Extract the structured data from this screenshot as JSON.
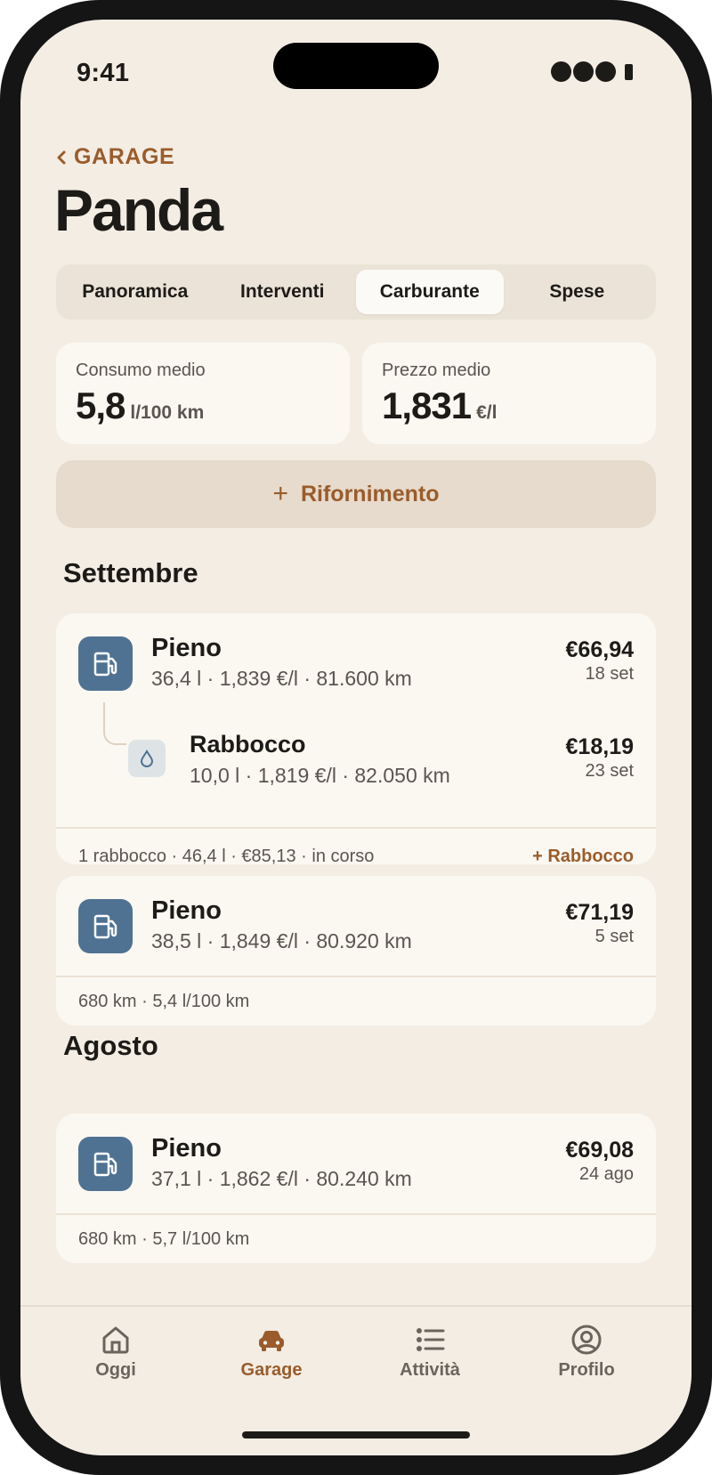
{
  "status_bar": {
    "time": "9:41"
  },
  "nav": {
    "back_label": "GARAGE",
    "title": "Panda"
  },
  "tabs": [
    {
      "label": "Panoramica",
      "active": false
    },
    {
      "label": "Interventi",
      "active": false
    },
    {
      "label": "Carburante",
      "active": true
    },
    {
      "label": "Spese",
      "active": false
    }
  ],
  "stats": {
    "consumption": {
      "label": "Consumo medio",
      "value": "5,8",
      "unit": "l/100 km"
    },
    "price": {
      "label": "Prezzo medio",
      "value": "1,831",
      "unit": "€/l"
    }
  },
  "add_button": {
    "label": "Rifornimento"
  },
  "months": [
    {
      "name": "Settembre",
      "cards": [
        {
          "entries": [
            {
              "type": "Pieno",
              "details": "36,4 l · 1,839 €/l · 81.600 km",
              "price": "€66,94",
              "date": "18 set"
            },
            {
              "type": "Rabbocco",
              "details": "10,0 l · 1,819 €/l · 82.050 km",
              "price": "€18,19",
              "date": "23 set"
            }
          ],
          "footer": "1 rabbocco · 46,4 l · €85,13 · in corso",
          "footer_action": "+ Rabbocco"
        },
        {
          "entries": [
            {
              "type": "Pieno",
              "details": "38,5 l · 1,849 €/l · 80.920 km",
              "price": "€71,19",
              "date": "5 set"
            }
          ],
          "footer": "680 km · 5,4 l/100 km"
        }
      ]
    },
    {
      "name": "Agosto",
      "cards": [
        {
          "entries": [
            {
              "type": "Pieno",
              "details": "37,1 l · 1,862 €/l · 80.240 km",
              "price": "€69,08",
              "date": "24 ago"
            }
          ],
          "footer": "680 km · 5,7 l/100 km"
        }
      ]
    }
  ],
  "tabbar": [
    {
      "label": "Oggi",
      "icon": "home-icon",
      "active": false
    },
    {
      "label": "Garage",
      "icon": "car-icon",
      "active": true
    },
    {
      "label": "Attività",
      "icon": "list-icon",
      "active": false
    },
    {
      "label": "Profilo",
      "icon": "profile-icon",
      "active": false
    }
  ],
  "colors": {
    "accent": "#9a5c2c",
    "fuel_icon": "#4f7292",
    "background": "#f3ede4",
    "card": "#fbf8f2"
  }
}
